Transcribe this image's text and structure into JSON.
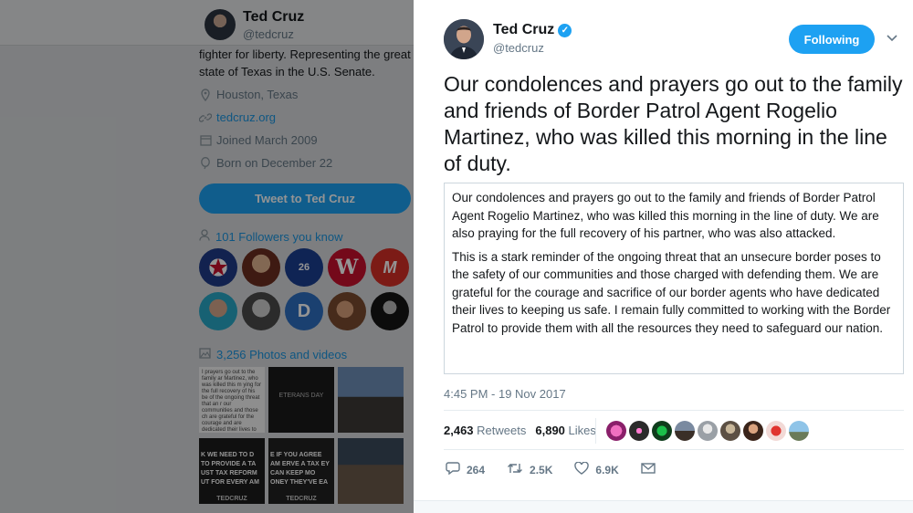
{
  "background_profile": {
    "name": "Ted Cruz",
    "handle": "@tedcruz",
    "bio_line1": "fighter for liberty. Representing the great",
    "bio_line2": "state of Texas in the U.S. Senate.",
    "location": "Houston, Texas",
    "website": "tedcruz.org",
    "joined": "Joined March 2009",
    "born": "Born on December 22",
    "tweet_to_button": "Tweet to Ted Cruz",
    "followers_you_know": "101 Followers you know",
    "photos_videos": "3,256 Photos and videos",
    "thumb_texts": {
      "t1": "I prayers go out to the family ar Martinez, who was killed this m ying for the full recovery of his be of the ongoing threat that an r our communities and those ch are grateful for the courage and are dedicated their lives to kee orking with the Border Patrol to to safeguard our nation.",
      "t2": "ETERANS DAY",
      "t4": "K WE NEED TO D TO PROVIDE A TA UST TAX REFORM UT FOR EVERY AM",
      "t5": "E IF YOU AGREE AM ERVE A TAX EY CAN KEEP MO ONEY THEY'VE EA",
      "brand": "TEDCRUZ"
    }
  },
  "tweet": {
    "author_name": "Ted Cruz",
    "author_handle": "@tedcruz",
    "follow_button": "Following",
    "text": "Our condolences and prayers go out to the family and friends of Border Patrol Agent Rogelio Martinez, who was killed this morning in the line of duty.",
    "image_paragraph1": "Our condolences and prayers go out to the family and friends of Border Patrol Agent Rogelio Martinez, who was killed this morning in the line of duty. We are also praying for the full recovery of his partner, who was also attacked.",
    "image_paragraph2": "This is a stark reminder of the ongoing threat that an unsecure border poses to the safety of our communities and those charged with defending them. We are grateful for the courage and sacrifice of our border agents who have dedicated their lives to keeping us safe. I remain fully committed to working with the Border Patrol to provide them with all the resources they need to safeguard our nation.",
    "timestamp": "4:45 PM - 19 Nov 2017",
    "retweets_count": "2,463",
    "retweets_label": "Retweets",
    "likes_count": "6,890",
    "likes_label": "Likes",
    "actions": {
      "reply": "264",
      "retweet": "2.5K",
      "like": "6.9K"
    }
  },
  "colors": {
    "accent": "#1da1f2",
    "text": "#14171a",
    "muted": "#657786"
  }
}
